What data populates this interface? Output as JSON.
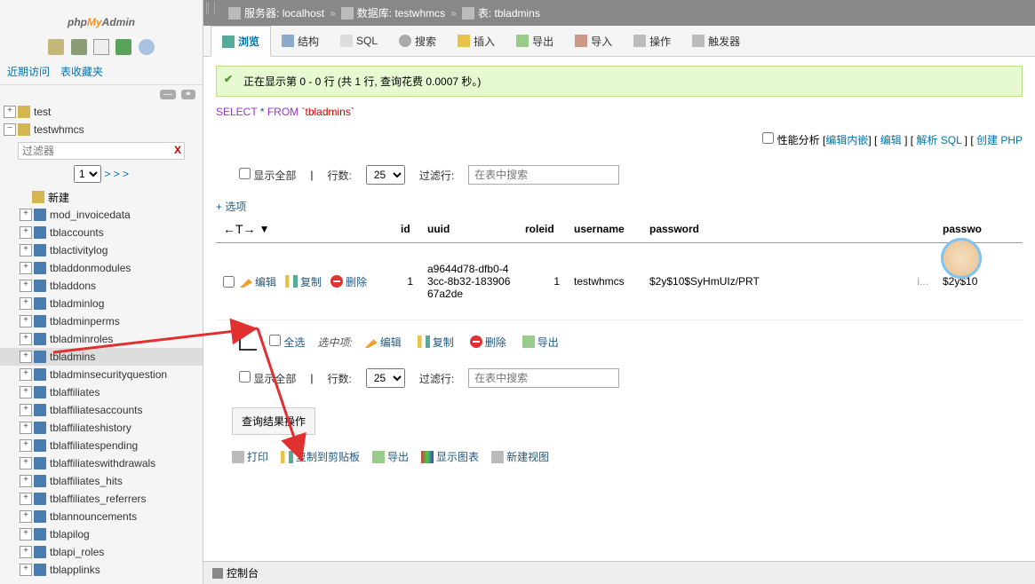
{
  "logo": {
    "p": "php",
    "m": "My",
    "a": "Admin"
  },
  "recent": {
    "tab1": "近期访问",
    "tab2": "表收藏夹"
  },
  "tree": {
    "db1": "test",
    "db2": "testwhmcs",
    "filter_ph": "过滤器",
    "page": "1",
    "more": "> > >",
    "new": "新建",
    "tables": [
      "mod_invoicedata",
      "tblaccounts",
      "tblactivitylog",
      "tbladdonmodules",
      "tbladdons",
      "tbladminlog",
      "tbladminperms",
      "tbladminroles",
      "tbladmins",
      "tbladminsecurityquestion",
      "tblaffiliates",
      "tblaffiliatesaccounts",
      "tblaffiliateshistory",
      "tblaffiliatespending",
      "tblaffiliateswithdrawals",
      "tblaffiliates_hits",
      "tblaffiliates_referrers",
      "tblannouncements",
      "tblapilog",
      "tblapi_roles",
      "tblapplinks"
    ]
  },
  "bc": {
    "srv_lbl": "服务器:",
    "srv": "localhost",
    "db_lbl": "数据库:",
    "db": "testwhmcs",
    "tbl_lbl": "表:",
    "tbl": "tbladmins"
  },
  "tabs": {
    "browse": "浏览",
    "struct": "结构",
    "sql": "SQL",
    "search": "搜索",
    "insert": "插入",
    "export": "导出",
    "import": "导入",
    "ops": "操作",
    "trig": "触发器"
  },
  "msg": "正在显示第 0 - 0 行 (共 1 行, 查询花费 0.0007 秒。)",
  "sql": {
    "select": "SELECT ",
    "star": "* ",
    "from": "FROM",
    "tbl": " `tbladmins`"
  },
  "links": {
    "perf": "性能分析",
    "e1": "编辑内嵌",
    "e2": "编辑",
    "e3": "解析 SQL",
    "e4": "创建 PHP"
  },
  "tb": {
    "showall": "显示全部",
    "rows_lbl": "行数:",
    "rows": "25",
    "filter_lbl": "过滤行:",
    "filter_ph": "在表中搜索"
  },
  "opt": "+ 选项",
  "cols": {
    "id": "id",
    "uuid": "uuid",
    "roleid": "roleid",
    "username": "username",
    "password": "password",
    "pass2": "passwo"
  },
  "row": {
    "edit": "编辑",
    "copy": "复制",
    "del": "删除",
    "id": "1",
    "uuid": "a9644d78-dfb0-43cc-8b32-18390667a2de",
    "roleid": "1",
    "username": "testwhmcs",
    "password": "$2y$10$SyHmUIz/PRT",
    "pass_suf": "i...",
    "pass2": "$2y$10"
  },
  "bulk": {
    "all": "全选",
    "label": "选中项:",
    "edit": "编辑",
    "copy": "复制",
    "del": "删除",
    "exp": "导出"
  },
  "qr": "查询结果操作",
  "rops": {
    "print": "打印",
    "clip": "复制到剪贴板",
    "exp": "导出",
    "chart": "显示图表",
    "view": "新建视图"
  },
  "footer": "控制台"
}
